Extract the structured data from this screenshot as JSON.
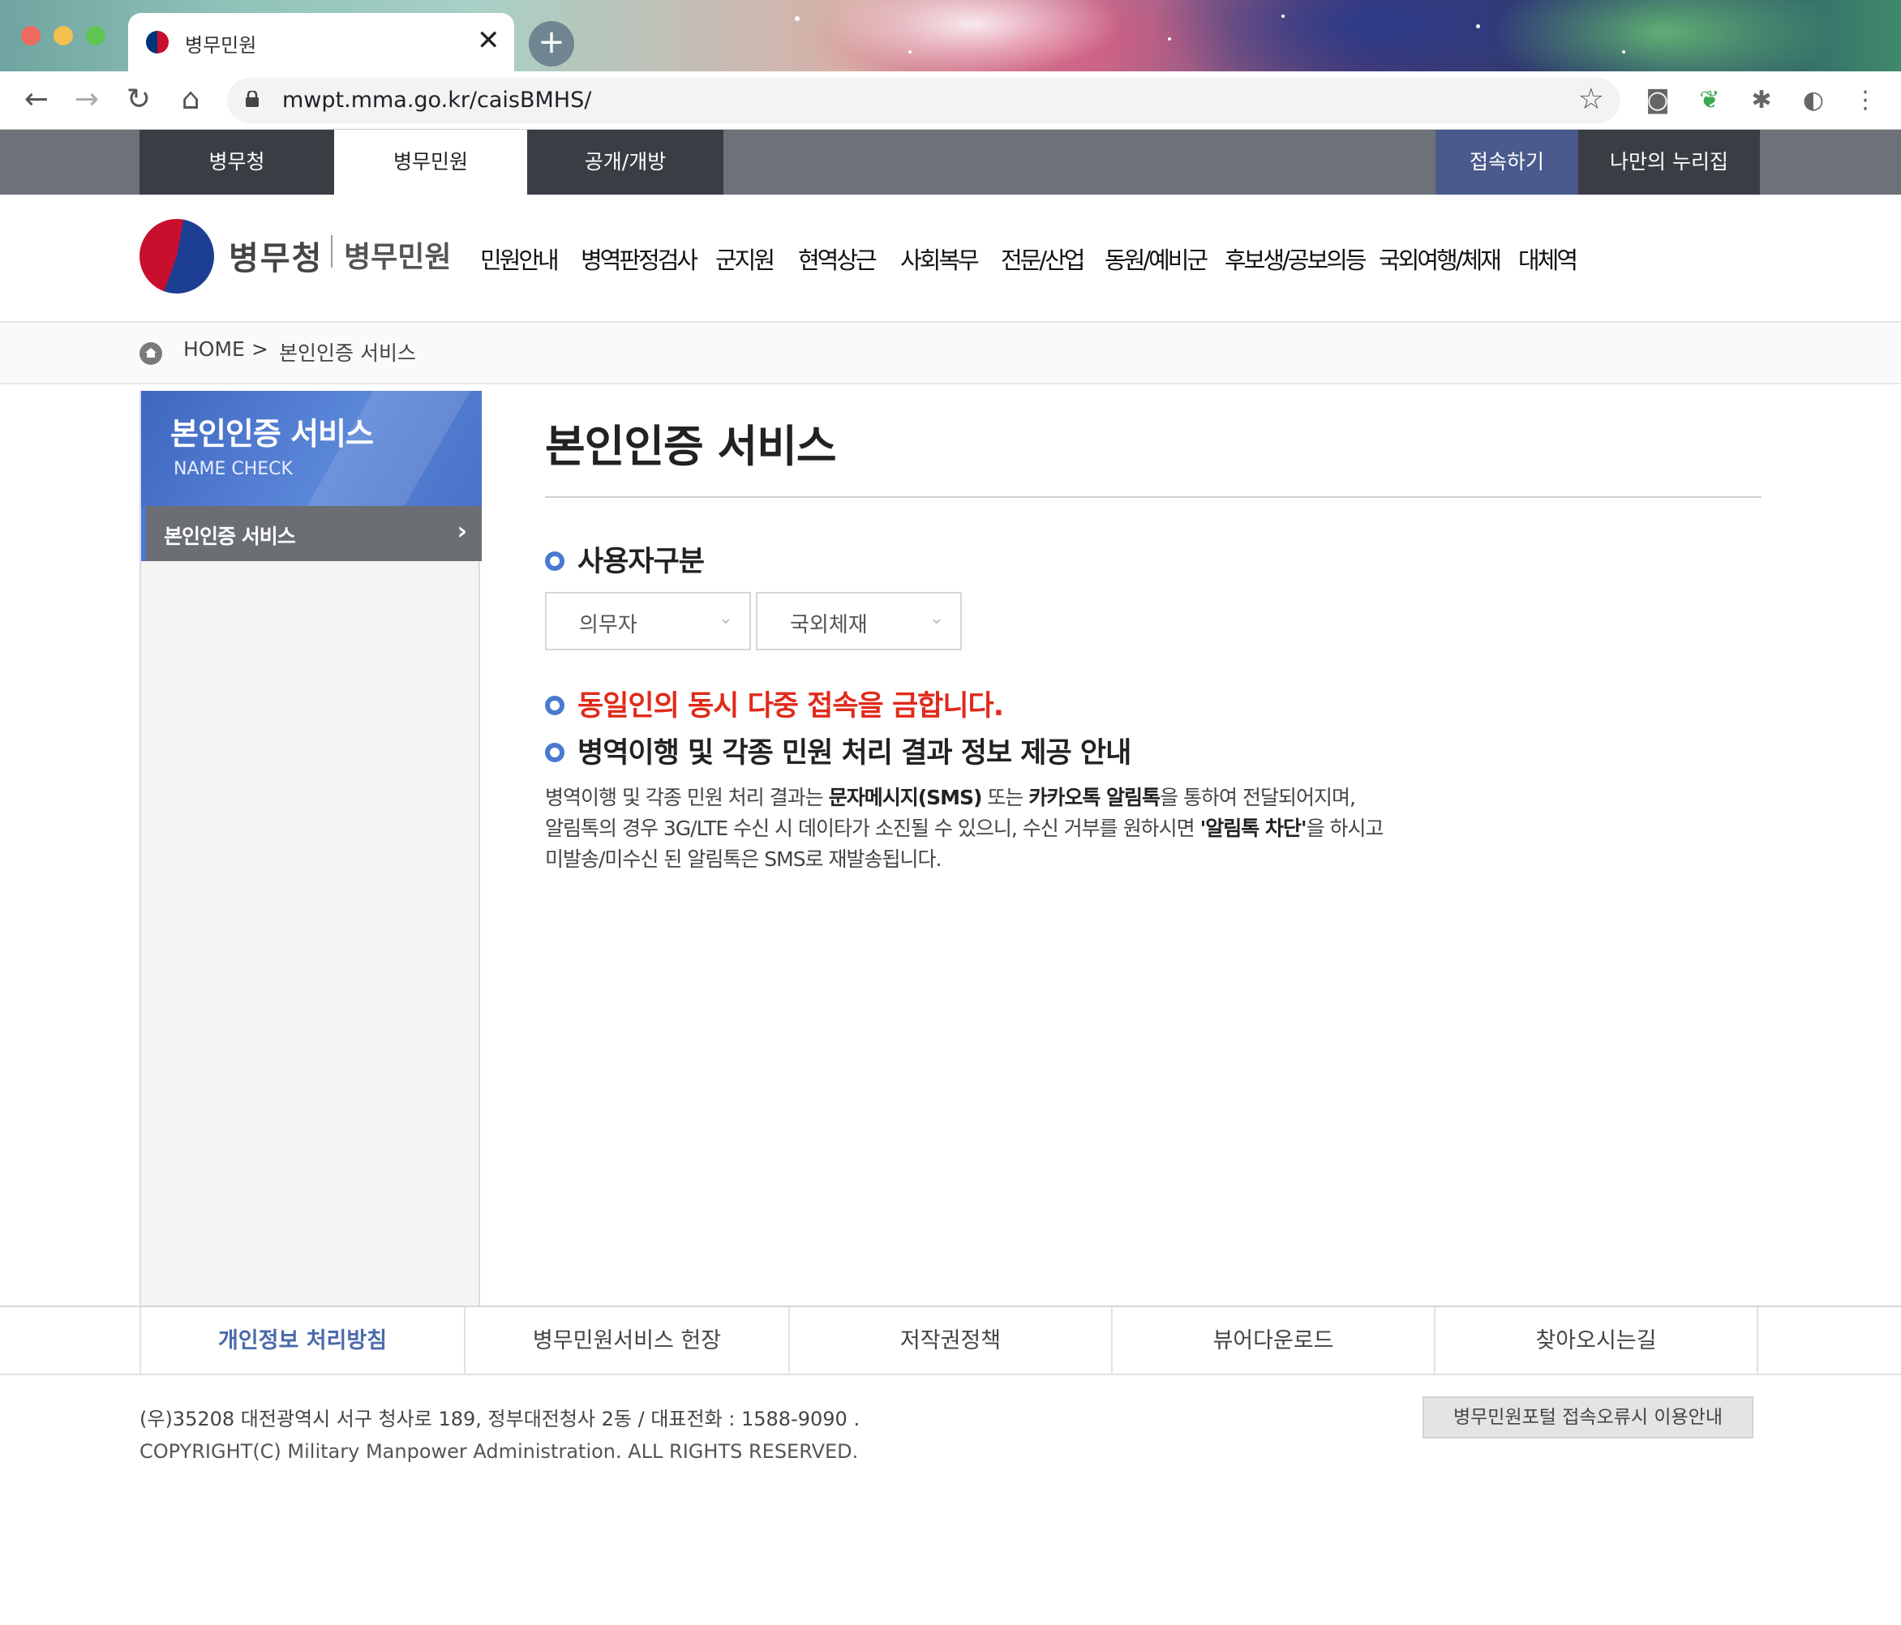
{
  "browser": {
    "tab_title": "병무민원",
    "tab_close": "✕",
    "new_tab": "+",
    "url": "mwpt.mma.go.kr/caisBMHS/"
  },
  "site_nav": {
    "items": [
      "병무청",
      "병무민원",
      "공개/개방"
    ],
    "active_index": 1,
    "login": "접속하기",
    "my_nurijip": "나만의 누리집"
  },
  "logo": {
    "main": "병무청",
    "sub": "병무민원"
  },
  "gnb": [
    "민원안내",
    "병역판정검사",
    "군지원",
    "현역상근",
    "사회복무",
    "전문/산업",
    "동원/예비군",
    "후보생/공보의등",
    "국외여행/체재",
    "대체역"
  ],
  "breadcrumb": {
    "home": "HOME",
    "separator": ">",
    "current": "본인인증 서비스"
  },
  "sidebar": {
    "title": "본인인증 서비스",
    "subtitle": "NAME CHECK",
    "items": [
      {
        "label": "본인인증 서비스"
      }
    ]
  },
  "main": {
    "title": "본인인증 서비스",
    "user_type_heading": "사용자구분",
    "select1": "의무자",
    "select2": "국외체재",
    "warning": "동일인의 동시 다중 접속을 금합니다.",
    "notice_heading": "병역이행 및 각종 민원 처리 결과 정보 제공 안내",
    "para1_a": "병역이행 및 각종 민원 처리 결과는 ",
    "para1_b": "문자메시지(SMS)",
    "para1_c": " 또는 ",
    "para1_d": "카카오톡 알림톡",
    "para1_e": "을 통하여 전달되어지며,",
    "para2_a": "알림톡의 경우 3G/LTE 수신 시 데이타가 소진될 수 있으니, 수신 거부를 원하시면 ",
    "para2_b": "'알림톡 차단'",
    "para2_c": "을 하시고",
    "para3": "미발송/미수신 된 알림톡은 SMS로 재발송됩니다."
  },
  "footer": {
    "links": [
      "개인정보 처리방침",
      "병무민원서비스 헌장",
      "저작권정책",
      "뷰어다운로드",
      "찾아오시는길"
    ],
    "address": "(우)35208 대전광역시 서구 청사로 189, 정부대전청사 2동 / 대표전화 : 1588-9090 .",
    "copyright": "COPYRIGHT(C) Military Manpower Administration. ALL RIGHTS RESERVED.",
    "error_button": "병무민원포털 접속오류시 이용안내"
  },
  "colors": {
    "accent_blue": "#4a7ad0",
    "warning_red": "#e02a1a",
    "topbar_dark": "#3a3e44",
    "login_blue": "#4a5a8c"
  }
}
